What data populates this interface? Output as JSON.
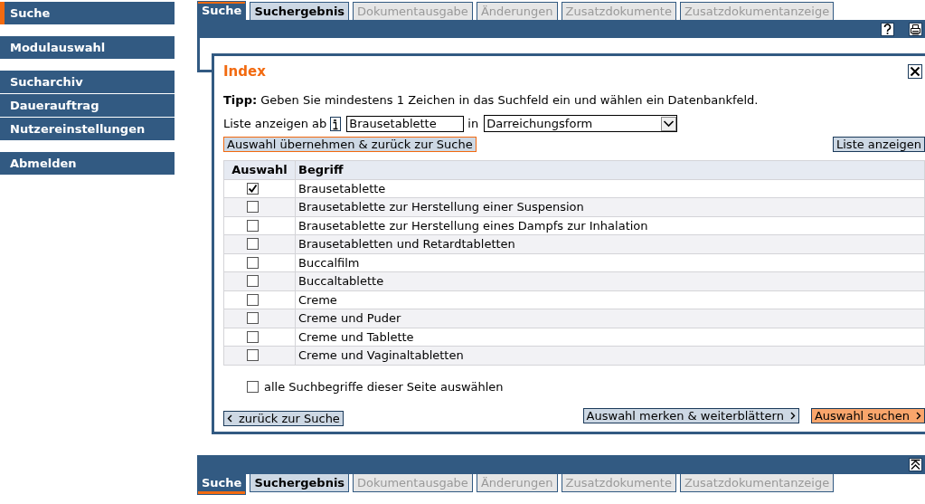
{
  "sidebar": {
    "groups": [
      {
        "items": [
          {
            "label": "Suche",
            "selected": true
          }
        ]
      },
      {
        "items": [
          {
            "label": "Modulauswahl",
            "selected": false
          }
        ]
      },
      {
        "items": [
          {
            "label": "Sucharchiv",
            "selected": false
          },
          {
            "label": "Dauerauftrag",
            "selected": false
          },
          {
            "label": "Nutzereinstellungen",
            "selected": false
          }
        ]
      },
      {
        "items": [
          {
            "label": "Abmelden",
            "selected": false
          }
        ]
      }
    ]
  },
  "top_tabs": [
    {
      "label": "Suche",
      "selected": true,
      "disabled": false
    },
    {
      "label": "Suchergebnis",
      "selected": false,
      "disabled": false
    },
    {
      "label": "Dokumentausgabe",
      "selected": false,
      "disabled": true
    },
    {
      "label": "Änderungen",
      "selected": false,
      "disabled": true
    },
    {
      "label": "Zusatzdokumente",
      "selected": false,
      "disabled": true
    },
    {
      "label": "Zusatzdokumentanzeige",
      "selected": false,
      "disabled": true
    }
  ],
  "index_panel": {
    "title": "Index",
    "tip": "**Tipp:** Geben Sie mindestens 1 Zeichen in das Suchfeld ein und wählen ein Datenbankfeld.",
    "list_label": "Liste anzeigen ab",
    "search_value": "Brausetablette",
    "in_label": "in",
    "field_value": "Darreichungsform",
    "apply_button": "Auswahl übernehmen & zurück zur Suche",
    "show_list_button": "Liste anzeigen",
    "table": {
      "columns": [
        "Auswahl",
        "Begriff"
      ],
      "rows": [
        {
          "term": "Brausetablette",
          "checked": true
        },
        {
          "term": "Brausetablette zur Herstellung einer Suspension",
          "checked": false
        },
        {
          "term": "Brausetablette zur Herstellung eines Dampfs zur Inhalation",
          "checked": false
        },
        {
          "term": "Brausetabletten und Retardtabletten",
          "checked": false
        },
        {
          "term": "Buccalfilm",
          "checked": false
        },
        {
          "term": "Buccaltablette",
          "checked": false
        },
        {
          "term": "Creme",
          "checked": false
        },
        {
          "term": "Creme und Puder",
          "checked": false
        },
        {
          "term": "Creme und Tablette",
          "checked": false
        },
        {
          "term": "Creme und Vaginaltabletten",
          "checked": false
        }
      ]
    },
    "select_all": {
      "label": "alle Suchbegriffe dieser Seite auswählen",
      "checked": false
    },
    "back_button": "zurück zur Suche",
    "remember_button": "Auswahl merken & weiterblättern",
    "search_button": "Auswahl suchen"
  },
  "bottom_tabs": [
    {
      "label": "Suche",
      "selected": true,
      "disabled": false
    },
    {
      "label": "Suchergebnis",
      "selected": false,
      "disabled": false
    },
    {
      "label": "Dokumentausgabe",
      "selected": false,
      "disabled": true
    },
    {
      "label": "Änderungen",
      "selected": false,
      "disabled": true
    },
    {
      "label": "Zusatzdokumente",
      "selected": false,
      "disabled": true
    },
    {
      "label": "Zusatzdokumentanzeige",
      "selected": false,
      "disabled": true
    }
  ]
}
